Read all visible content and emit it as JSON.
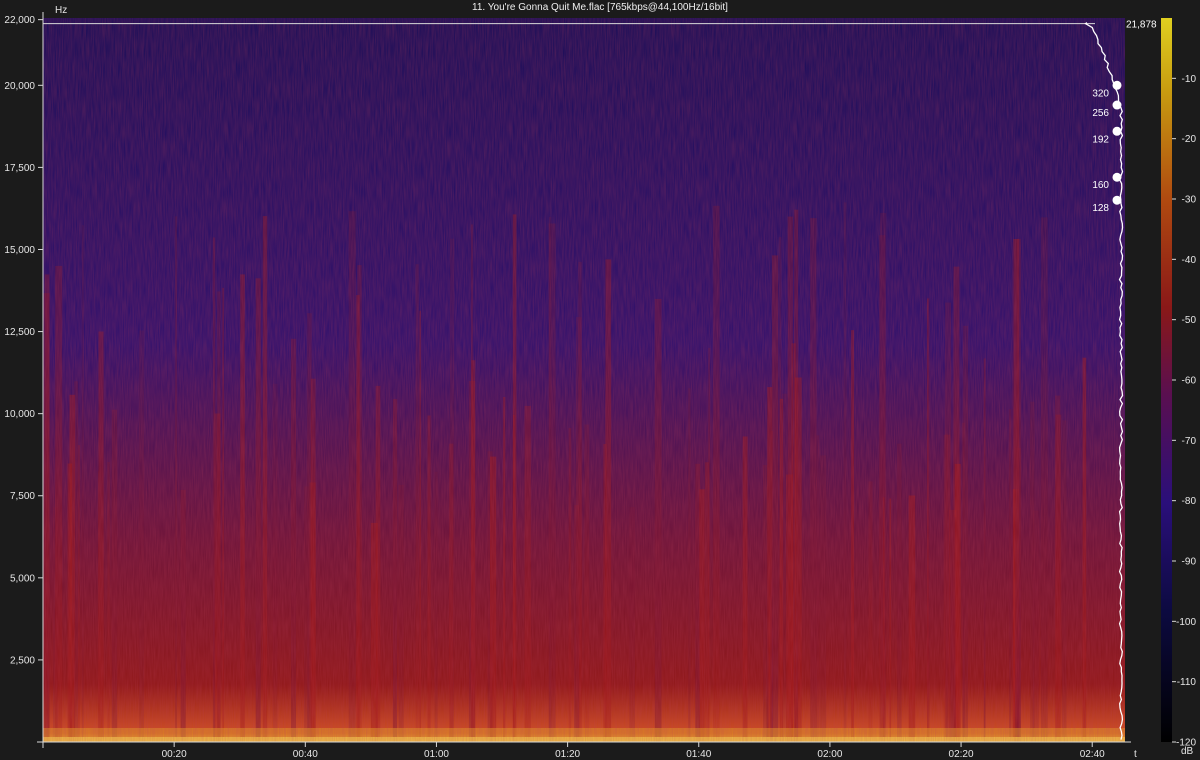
{
  "window": {
    "title": "11. You're Gonna Quit Me.flac [765kbps@44,100Hz/16bit]"
  },
  "chart_data": {
    "type": "heatmap",
    "title": "11. You're Gonna Quit Me.flac [765kbps@44,100Hz/16bit]",
    "ylabel": "Hz",
    "xlabel": "t",
    "colorbar_label": "dB",
    "y_ticks": [
      "2,500",
      "5,000",
      "7,500",
      "10,000",
      "12,500",
      "15,000",
      "17,500",
      "20,000",
      "22,000"
    ],
    "y_tick_values": [
      2500,
      5000,
      7500,
      10000,
      12500,
      15000,
      17500,
      20000,
      22000
    ],
    "ylim": [
      0,
      22050
    ],
    "x_ticks": [
      "00:20",
      "00:40",
      "01:00",
      "01:20",
      "01:40",
      "02:00",
      "02:20",
      "02:40"
    ],
    "x_tick_values": [
      20,
      40,
      60,
      80,
      100,
      120,
      140,
      160
    ],
    "xlim": [
      0,
      165
    ],
    "colorbar_ticks": [
      "-10",
      "-20",
      "-30",
      "-40",
      "-50",
      "-60",
      "-70",
      "-80",
      "-90",
      "-100",
      "-110",
      "-120"
    ],
    "colorbar_values": [
      -10,
      -20,
      -30,
      -40,
      -50,
      -60,
      -70,
      -80,
      -90,
      -100,
      -110,
      -120
    ],
    "colorbar_range": [
      -120,
      0
    ],
    "cutoff_label": "21,878",
    "cutoff_hz": 21878,
    "bitrate_markers": [
      {
        "label": "320",
        "hz": 20000
      },
      {
        "label": "256",
        "hz": 19400
      },
      {
        "label": "192",
        "hz": 18600
      },
      {
        "label": "160",
        "hz": 17200
      },
      {
        "label": "128",
        "hz": 16500
      }
    ],
    "colors": {
      "background": "#1b1b1b",
      "low": "#120c5a",
      "mid": "#8a1414",
      "high": "#e8c030",
      "curve": "#ffffff"
    }
  }
}
